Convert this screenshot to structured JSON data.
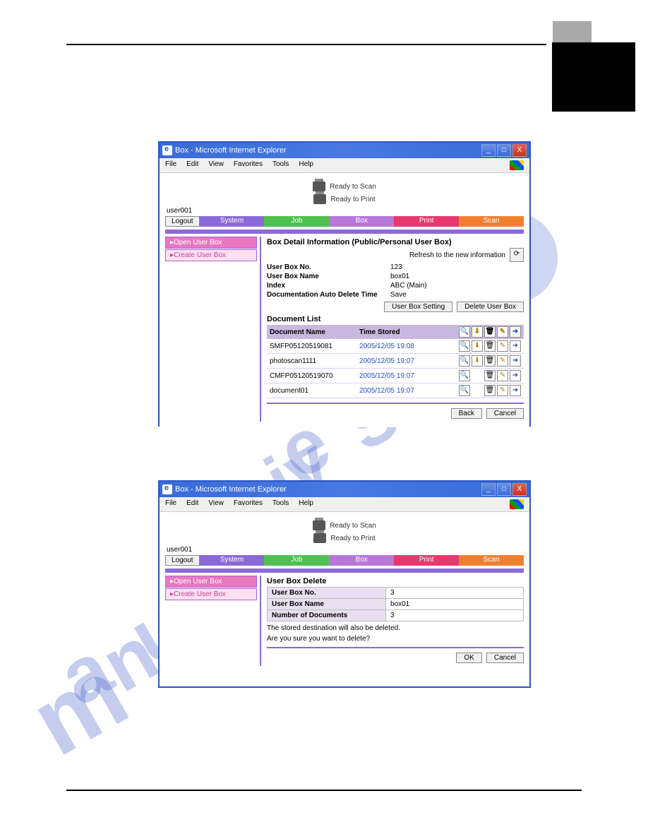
{
  "window": {
    "title": "Box - Microsoft Internet Explorer",
    "menus": [
      "File",
      "Edit",
      "View",
      "Favorites",
      "Tools",
      "Help"
    ]
  },
  "status": {
    "scan": "Ready to Scan",
    "print": "Ready to Print"
  },
  "user": "user001",
  "logout": "Logout",
  "tabs": {
    "system": "System",
    "job": "Job",
    "box": "Box",
    "print": "Print",
    "scan": "Scan"
  },
  "sidebar": {
    "open": "▸Open User Box",
    "create": "▸Create User Box"
  },
  "panel1": {
    "title": "Box Detail Information (Public/Personal User Box)",
    "refresh": "Refresh to the new information",
    "fields": {
      "no_k": "User Box No.",
      "no_v": "123",
      "name_k": "User Box Name",
      "name_v": "box01",
      "index_k": "Index",
      "index_v": "ABC  (Main)",
      "auto_k": "Documentation Auto Delete Time",
      "auto_v": "Save"
    },
    "btn_setting": "User Box Setting",
    "btn_delete": "Delete User Box",
    "doclist_title": "Document List",
    "th_name": "Document Name",
    "th_time": "Time Stored",
    "docs": [
      {
        "name": "SMFP05120519081",
        "time": "2005/12/05  19:08"
      },
      {
        "name": "photoscan1111",
        "time": "2005/12/05  19:07"
      },
      {
        "name": "CMFP05120519070",
        "time": "2005/12/05  19:07"
      },
      {
        "name": "document01",
        "time": "2005/12/05  19:07"
      }
    ],
    "btn_back": "Back",
    "btn_cancel": "Cancel"
  },
  "panel2": {
    "title": "User Box Delete",
    "no_k": "User Box No.",
    "no_v": "3",
    "name_k": "User Box Name",
    "name_v": "box01",
    "num_k": "Number of Documents",
    "num_v": "3",
    "warn1": "The stored destination will also be deleted.",
    "warn2": "Are you sure you want to delete?",
    "btn_ok": "OK",
    "btn_cancel": "Cancel"
  }
}
